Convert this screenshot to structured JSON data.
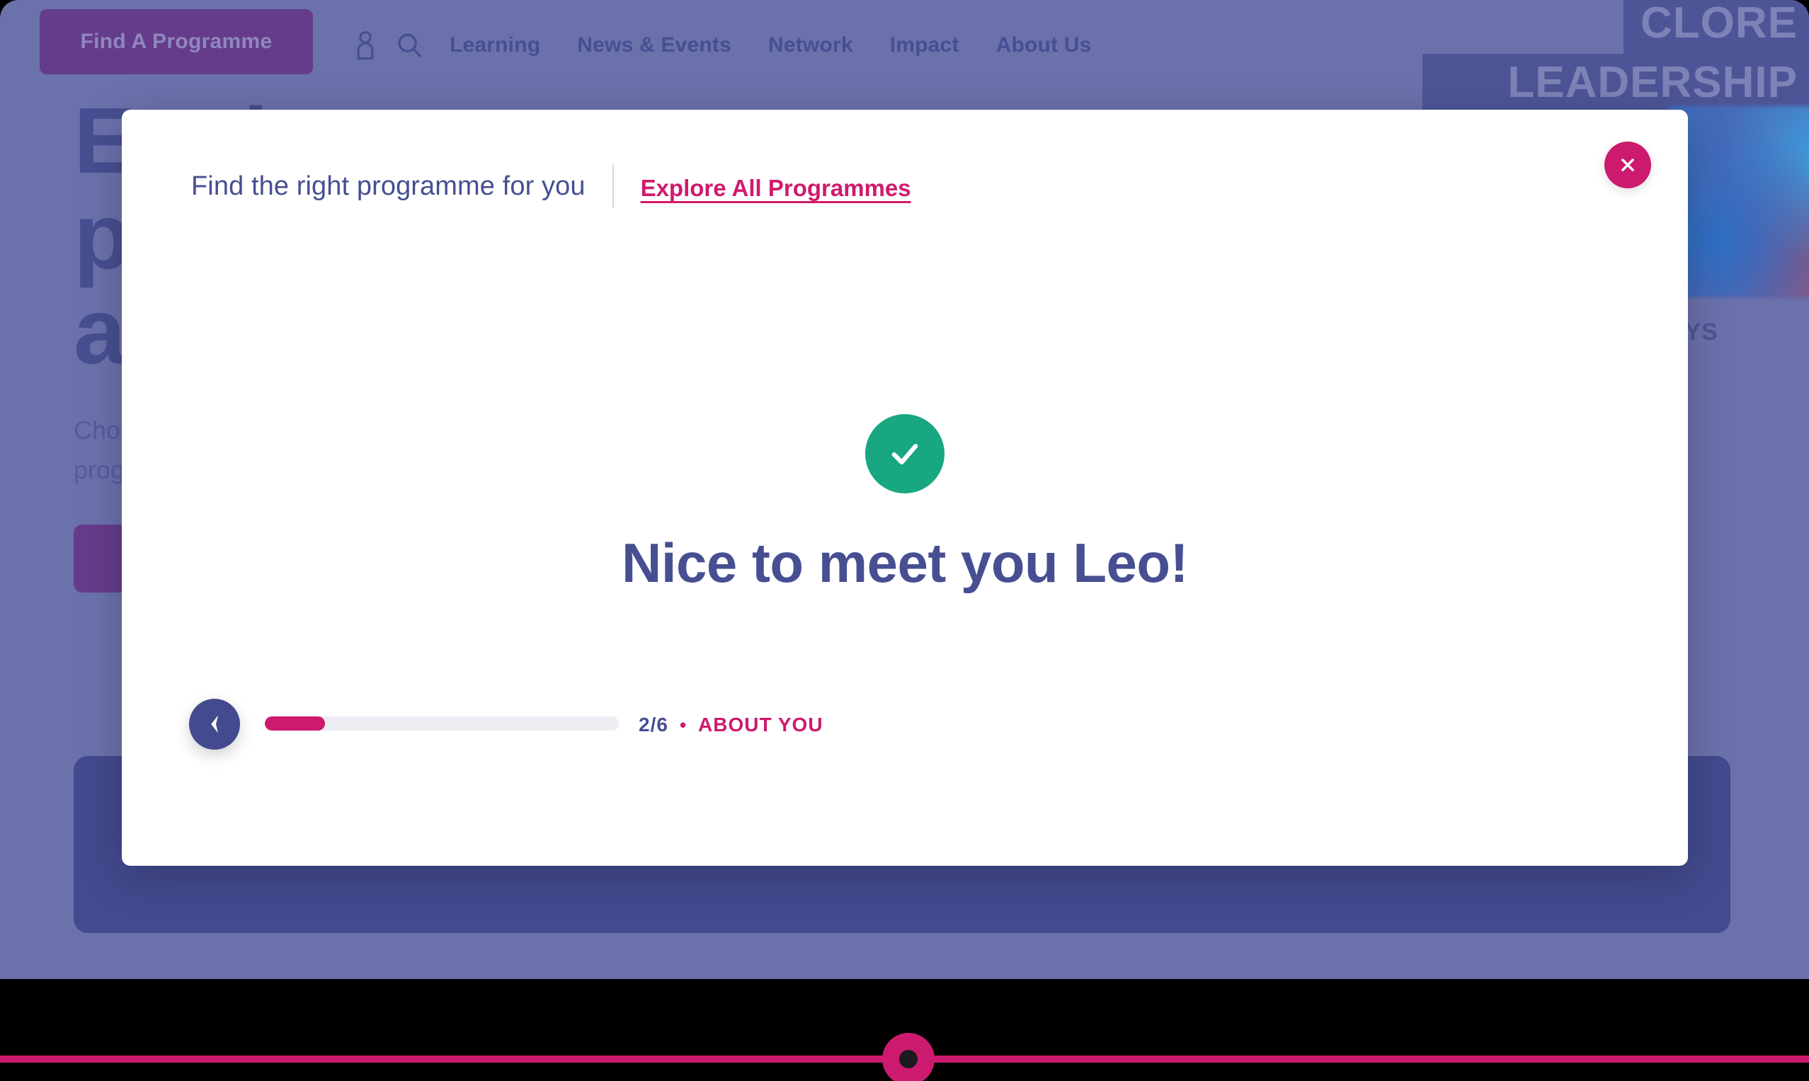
{
  "site": {
    "cta_label": "Find A Programme",
    "nav": [
      {
        "name": "account",
        "icon": "person-icon"
      },
      {
        "name": "search",
        "icon": "search-icon"
      },
      {
        "name": "learning",
        "label": "Learning"
      },
      {
        "name": "news-events",
        "label": "News & Events"
      },
      {
        "name": "network",
        "label": "Network"
      },
      {
        "name": "impact",
        "label": "Impact"
      },
      {
        "name": "about-us",
        "label": "About Us"
      }
    ],
    "logo": {
      "line1": "CLORE",
      "line2": "LEADERSHIP"
    }
  },
  "hero": {
    "heading": "Explore our\nprogrammes\nand courses",
    "body": "Choose from a wide range of leadership\nprogrammes designed for you.",
    "side_card_label": "AYS"
  },
  "modal": {
    "title": "Find the right programme for you",
    "explore_link": "Explore All Programmes",
    "close_icon": "close-icon",
    "success_icon": "check-icon",
    "confirmation_heading": "Nice to meet you Leo!",
    "footer": {
      "back_icon": "chevron-left-icon",
      "progress_percent": 17,
      "step_count": "2/6",
      "separator": "•",
      "step_label": "ABOUT YOU"
    }
  },
  "bottom_bar": {
    "knob_icon": "scroll-indicator-icon"
  },
  "colors": {
    "page_background": "#6b71ab",
    "indigo": "#474f92",
    "dark_indigo": "#434a8e",
    "purple": "#653c8c",
    "pink": "#cc1a6e",
    "green": "#18a781",
    "white": "#ffffff"
  }
}
